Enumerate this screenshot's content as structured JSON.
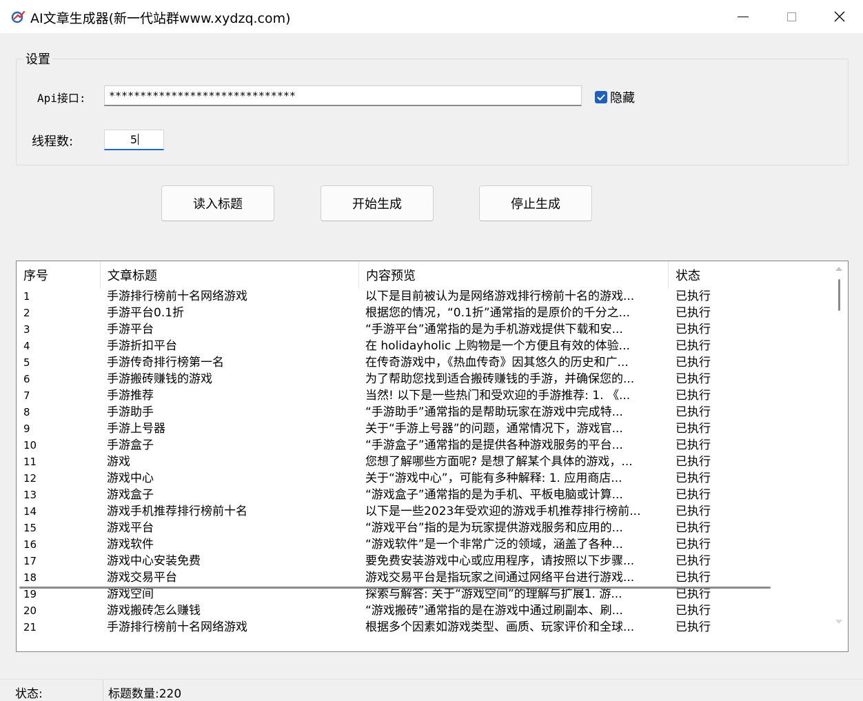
{
  "window": {
    "title": "AI文章生成器(新一代站群www.xydzq.com)"
  },
  "settings": {
    "group_title": "设置",
    "api_label": "Api接口:",
    "api_value": "******************************",
    "hide_checkbox_label": "隐藏",
    "hide_checked": true,
    "thread_label": "线程数:",
    "thread_value": "5"
  },
  "buttons": {
    "read_titles": "读入标题",
    "start": "开始生成",
    "stop": "停止生成"
  },
  "table": {
    "columns": [
      "序号",
      "文章标题",
      "内容预览",
      "状态"
    ],
    "rows": [
      {
        "n": "1",
        "title": "手游排行榜前十名网络游戏",
        "preview": "以下是目前被认为是网络游戏排行榜前十名的游戏...",
        "status": "已执行"
      },
      {
        "n": "2",
        "title": "手游平台0.1折",
        "preview": "根据您的情况，“0.1折”通常指的是原价的千分之...",
        "status": "已执行"
      },
      {
        "n": "3",
        "title": "手游平台",
        "preview": "“手游平台”通常指的是为手机游戏提供下载和安...",
        "status": "已执行"
      },
      {
        "n": "4",
        "title": "手游折扣平台",
        "preview": "在 holidayholic 上购物是一个方便且有效的体验...",
        "status": "已执行"
      },
      {
        "n": "5",
        "title": "手游传奇排行榜第一名",
        "preview": "在传奇游戏中，《热血传奇》因其悠久的历史和广...",
        "status": "已执行"
      },
      {
        "n": "6",
        "title": "手游搬砖赚钱的游戏",
        "preview": "为了帮助您找到适合搬砖赚钱的手游，并确保您的...",
        "status": "已执行"
      },
      {
        "n": "7",
        "title": "手游推荐",
        "preview": "当然! 以下是一些热门和受欢迎的手游推荐: 1. 《...",
        "status": "已执行"
      },
      {
        "n": "8",
        "title": "手游助手",
        "preview": "“手游助手”通常指的是帮助玩家在游戏中完成特...",
        "status": "已执行"
      },
      {
        "n": "9",
        "title": "手游上号器",
        "preview": "关于“手游上号器”的问题，通常情况下，游戏官...",
        "status": "已执行"
      },
      {
        "n": "10",
        "title": "手游盒子",
        "preview": "“手游盒子”通常指的是提供各种游戏服务的平台...",
        "status": "已执行"
      },
      {
        "n": "11",
        "title": "游戏",
        "preview": "您想了解哪些方面呢? 是想了解某个具体的游戏，...",
        "status": "已执行"
      },
      {
        "n": "12",
        "title": "游戏中心",
        "preview": "关于“游戏中心”，可能有多种解释: 1. 应用商店...",
        "status": "已执行"
      },
      {
        "n": "13",
        "title": "游戏盒子",
        "preview": "“游戏盒子”通常指的是为手机、平板电脑或计算...",
        "status": "已执行"
      },
      {
        "n": "14",
        "title": "游戏手机推荐排行榜前十名",
        "preview": "以下是一些2023年受欢迎的游戏手机推荐排行榜前...",
        "status": "已执行"
      },
      {
        "n": "15",
        "title": "游戏平台",
        "preview": "“游戏平台”指的是为玩家提供游戏服务和应用的...",
        "status": "已执行"
      },
      {
        "n": "16",
        "title": "游戏软件",
        "preview": "“游戏软件”是一个非常广泛的领域，涵盖了各种...",
        "status": "已执行"
      },
      {
        "n": "17",
        "title": "游戏中心安装免费",
        "preview": "要免费安装游戏中心或应用程序，请按照以下步骤...",
        "status": "已执行"
      },
      {
        "n": "18",
        "title": "游戏交易平台",
        "preview": "游戏交易平台是指玩家之间通过网络平台进行游戏...",
        "status": "已执行"
      },
      {
        "n": "19",
        "title": "游戏空间",
        "preview": "探索与解答: 关于“游戏空间”的理解与扩展1. 游...",
        "status": "已执行"
      },
      {
        "n": "20",
        "title": "游戏搬砖怎么赚钱",
        "preview": "“游戏搬砖”通常指的是在游戏中通过刷副本、刷...",
        "status": "已执行"
      },
      {
        "n": "21",
        "title": "手游排行榜前十名网络游戏",
        "preview": "根据多个因素如游戏类型、画质、玩家评价和全球...",
        "status": "已执行"
      }
    ]
  },
  "statusbar": {
    "status_label": "状态:",
    "count_text": "标题数量:220"
  },
  "colors": {
    "accent": "#1f5fbf",
    "background": "#f0f0f0"
  }
}
